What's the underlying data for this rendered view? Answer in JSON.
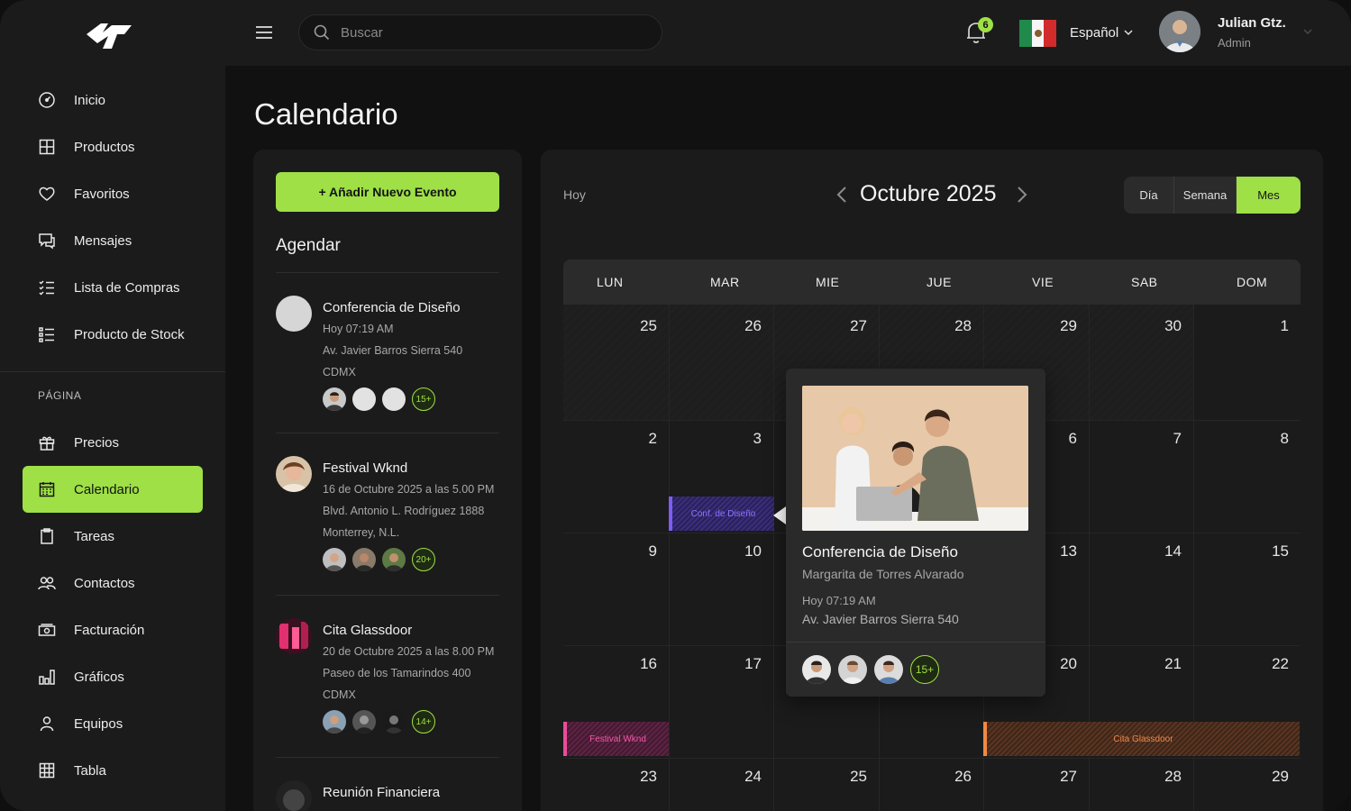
{
  "header": {
    "search_placeholder": "Buscar",
    "notifications_count": "6",
    "language": "Español",
    "user_name": "Julian Gtz.",
    "user_role": "Admin"
  },
  "sidebar": {
    "items": [
      {
        "label": "Inicio",
        "icon": "dashboard-icon"
      },
      {
        "label": "Productos",
        "icon": "grid-icon"
      },
      {
        "label": "Favoritos",
        "icon": "heart-icon"
      },
      {
        "label": "Mensajes",
        "icon": "chat-icon"
      },
      {
        "label": "Lista de Compras",
        "icon": "checklist-icon"
      },
      {
        "label": "Producto de Stock",
        "icon": "list-icon"
      }
    ],
    "section_label": "PÁGINA",
    "page_items": [
      {
        "label": "Precios",
        "icon": "gift-icon"
      },
      {
        "label": "Calendario",
        "icon": "calendar-icon",
        "active": true
      },
      {
        "label": "Tareas",
        "icon": "clipboard-icon"
      },
      {
        "label": "Contactos",
        "icon": "users-icon"
      },
      {
        "label": "Facturación",
        "icon": "money-icon"
      },
      {
        "label": "Gráficos",
        "icon": "bar-chart-icon"
      },
      {
        "label": "Equipos",
        "icon": "user-icon"
      },
      {
        "label": "Tabla",
        "icon": "table-icon"
      }
    ]
  },
  "page": {
    "title": "Calendario"
  },
  "agenda": {
    "add_button": "+ Añadir Nuevo Evento",
    "title": "Agendar",
    "events": [
      {
        "title": "Conferencia de Diseño",
        "line1": "Hoy 07:19 AM",
        "line2": "Av. Javier Barros Sierra 540",
        "line3": "CDMX",
        "more": "15+"
      },
      {
        "title": "Festival Wknd",
        "line1": "16 de Octubre 2025 a las 5.00 PM",
        "line2": "Blvd. Antonio L. Rodríguez 1888",
        "line3": "Monterrey, N.L.",
        "more": "20+"
      },
      {
        "title": "Cita Glassdoor",
        "line1": "20 de Octubre 2025 a las 8.00 PM",
        "line2": "Paseo de los Tamarindos 400",
        "line3": "CDMX",
        "more": "14+"
      },
      {
        "title": "Reunión Financiera",
        "line1": "",
        "line2": "",
        "line3": "",
        "more": ""
      }
    ]
  },
  "calendar": {
    "today_label": "Hoy",
    "month_title": "Octubre 2025",
    "views": {
      "day": "Día",
      "week": "Semana",
      "month": "Mes",
      "selected": "Mes"
    },
    "weekdays": [
      "LUN",
      "MAR",
      "MIE",
      "JUE",
      "VIE",
      "SAB",
      "DOM"
    ],
    "weeks": [
      [
        "25",
        "26",
        "27",
        "28",
        "29",
        "30",
        "1"
      ],
      [
        "2",
        "3",
        "",
        "",
        "6",
        "7",
        "8"
      ],
      [
        "9",
        "10",
        "",
        "",
        "13",
        "14",
        "15"
      ],
      [
        "16",
        "17",
        "",
        "",
        "20",
        "21",
        "22"
      ],
      [
        "23",
        "24",
        "25",
        "26",
        "27",
        "28",
        "29"
      ]
    ],
    "event_bars": {
      "conf": "Conf. de Diseño",
      "fest": "Festival Wknd",
      "cita": "Cita Glassdoor"
    },
    "colors": {
      "accent": "#9ee046",
      "conf": "#7f5cf5",
      "fest": "#e94d9c",
      "cita": "#f08a43"
    }
  },
  "popover": {
    "title": "Conferencia de Diseño",
    "subtitle": "Margarita de Torres Alvarado",
    "time": "Hoy 07:19 AM",
    "address": "Av. Javier Barros Sierra 540",
    "more": "15+"
  }
}
